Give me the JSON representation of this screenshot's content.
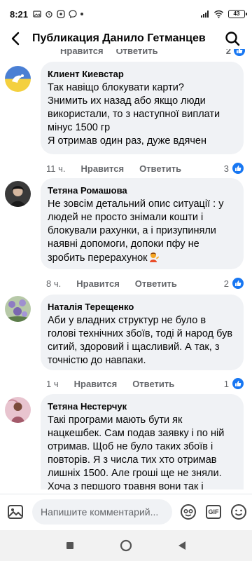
{
  "status_bar": {
    "time": "8:21",
    "battery": "43"
  },
  "header": {
    "title": "Публикация Данило Гетманцев"
  },
  "peek": {
    "like_label": "Нравится",
    "reply_label": "Ответить",
    "count": "2"
  },
  "comments": [
    {
      "author": "Клиент Киевстар",
      "text": "Так навіщо блокувати карти?\nЗнимить их назад  або якщо люди використали, то з наступної виплати мінус 1500 гр\nЯ отримав один раз, дуже вдячен",
      "time": "11 ч.",
      "like_label": "Нравится",
      "reply_label": "Ответить",
      "reactions": "3"
    },
    {
      "author": "Тетяна Ромашова",
      "text": "Не зовсім детальний опис ситуації : у людей не просто знімали кошти  і блокували рахунки, а і призупиняли наявні допомоги, допоки пфу не зробить перерахунок",
      "emoji": "person-tipping-hand-emoji",
      "time": "8 ч.",
      "like_label": "Нравится",
      "reply_label": "Ответить",
      "reactions": "2"
    },
    {
      "author": "Наталія Терещенко",
      "text": "Аби у владних структур не було в голові технічних збоїв, тоді й народ був ситий, здоровий і щасливий. А так, з точністю до навпаки.",
      "time": "1 ч",
      "like_label": "Нравится",
      "reply_label": "Ответить",
      "reactions": "1"
    },
    {
      "author": "Тетяна Нестерчук",
      "text": "Такі програми мають бути як нацкешбек. Сам подав заявку і по ній отримав. Щоб не було таких збоїв і повторів. Я з числа тих хто отримав лишніх 1500. Але гроші ще не зняли. Хоча з першого травня вони так і"
    }
  ],
  "composer": {
    "placeholder": "Напишите комментарий..."
  },
  "colors": {
    "accent": "#1877f2",
    "bubble": "#f0f2f5",
    "meta": "#65676b"
  }
}
